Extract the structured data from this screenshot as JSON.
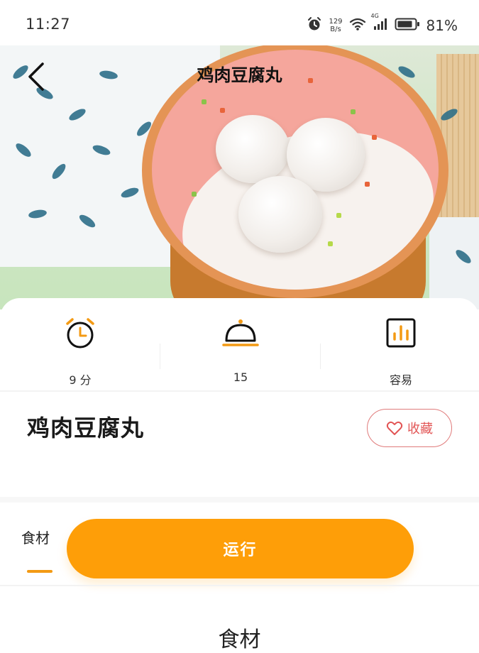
{
  "status_bar": {
    "time": "11:27",
    "net_speed_value": "129",
    "net_speed_unit": "B/s",
    "signal_type": "4G",
    "battery_percent": "81%",
    "icons": [
      "alarm-icon",
      "wifi-icon",
      "signal-icon",
      "battery-icon"
    ]
  },
  "header": {
    "title": "鸡肉豆腐丸",
    "back_icon": "chevron-left-icon"
  },
  "stats": [
    {
      "icon": "alarm-clock-icon",
      "label": "9 分"
    },
    {
      "icon": "serving-dome-icon",
      "label": "15"
    },
    {
      "icon": "difficulty-chart-icon",
      "label": "容易"
    }
  ],
  "recipe": {
    "title": "鸡肉豆腐丸",
    "favorite_label": "收藏"
  },
  "tabs": {
    "ingredients_label": "食材"
  },
  "run_button": {
    "label": "运行"
  },
  "section": {
    "heading": "食材"
  },
  "colors": {
    "accent": "#fe9e08",
    "favorite": "#e25555",
    "icon_orange": "#f39a14"
  }
}
